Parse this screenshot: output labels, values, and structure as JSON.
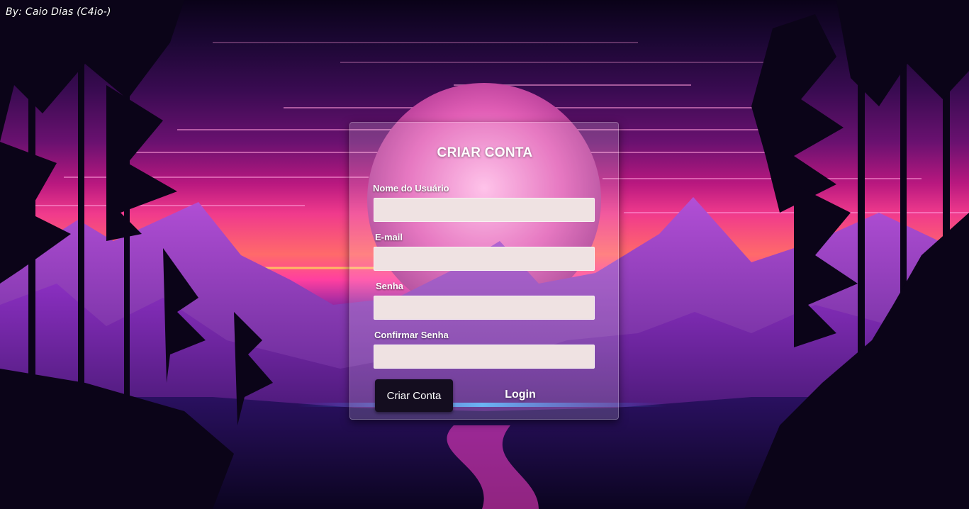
{
  "author": "By: Caio Dias (C4io-)",
  "form": {
    "title": "CRIAR CONTA",
    "fields": [
      {
        "label": "Nome do Usuário",
        "value": "",
        "placeholder": ""
      },
      {
        "label": "E-mail",
        "value": "",
        "placeholder": ""
      },
      {
        "label": "Senha",
        "value": "",
        "placeholder": ""
      },
      {
        "label": "Confirmar Senha",
        "value": "",
        "placeholder": ""
      }
    ],
    "submit_label": "Criar Conta",
    "login_label": "Login"
  },
  "colors": {
    "card_background": "rgba(255,255,255,0.16)",
    "input_background": "#efe2e2",
    "button_background": "#140d1f",
    "text": "#ffffff"
  }
}
